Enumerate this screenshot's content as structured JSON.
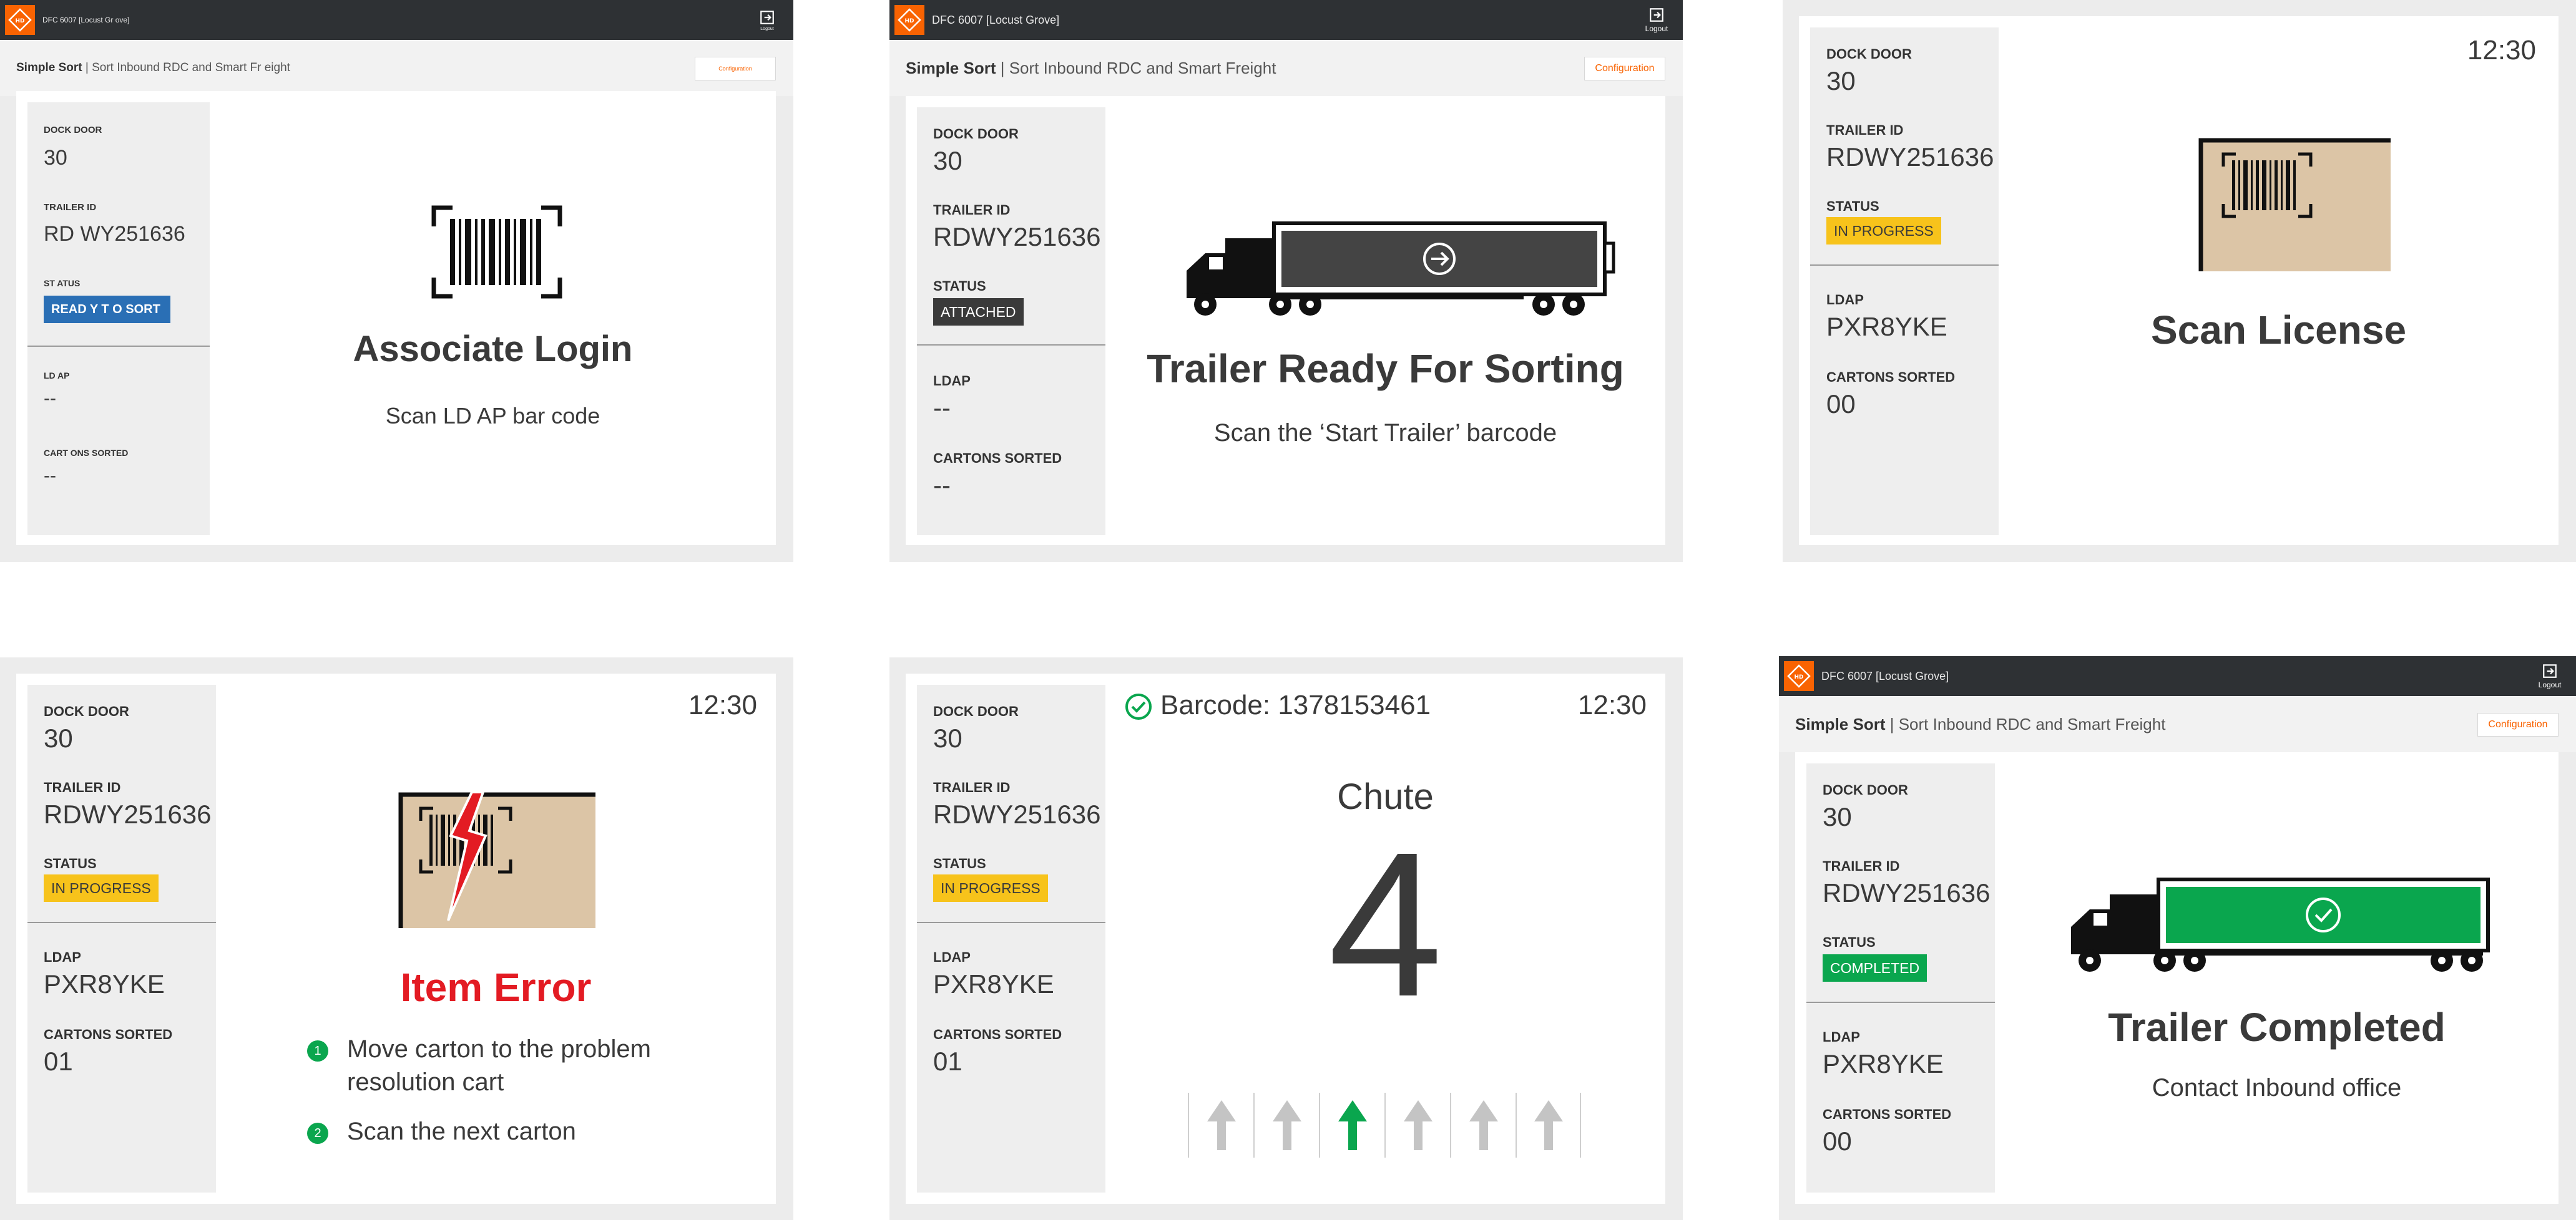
{
  "app": {
    "store_title": "DFC 6007 [Locust Grove]",
    "store_title_panel1": "DFC 6007 [Locust Gr        ove]",
    "logout_label": "Logout",
    "subheader_app": "Simple Sort",
    "subheader_desc": "| Sort Inbound RDC and Smart Freight",
    "subheader_desc_panel1": "| Sort Inbound RDC and Smart Fr        eight",
    "config_label": "Configuration"
  },
  "labels": {
    "dock_door": "DOCK DOOR",
    "trailer_id": "TRAILER ID",
    "status": "STATUS",
    "ldap": "LDAP",
    "cartons_sorted": "CARTONS SORTED"
  },
  "panel1": {
    "labels": {
      "dock_door": "DOCK DOOR",
      "trailer_id": "TRAILER ID",
      "status": "ST  ATUS",
      "ldap": "LD  AP",
      "cartons_sorted": "CART    ONS SORTED"
    },
    "dock_door": "30",
    "trailer_id": "RD WY251636",
    "status": "READ  Y T  O SORT",
    "ldap": "--",
    "cartons": "--",
    "title": "Associate Login",
    "subtitle": "Scan LD  AP bar  code"
  },
  "panel2": {
    "dock_door": "30",
    "trailer_id": "RDWY251636",
    "status": "ATTACHED",
    "ldap": "--",
    "cartons": "--",
    "title": "Trailer Ready For Sorting",
    "subtitle": "Scan the ‘Start Trailer’ barcode"
  },
  "panel3": {
    "dock_door": "30",
    "trailer_id": "RDWY251636",
    "status": "IN PROGRESS",
    "ldap": "PXR8YKE",
    "cartons": "00",
    "clock": "12:30",
    "title": "Scan License"
  },
  "panel4": {
    "dock_door": "30",
    "trailer_id": "RDWY251636",
    "status": "IN PROGRESS",
    "ldap": "PXR8YKE",
    "cartons": "01",
    "clock": "12:30",
    "title": "Item Error",
    "steps": [
      {
        "num": "1",
        "line1": "Move carton to the problem",
        "line2": "resolution cart"
      },
      {
        "num": "2",
        "line1": "Scan the next carton"
      }
    ]
  },
  "panel5": {
    "dock_door": "30",
    "trailer_id": "RDWY251636",
    "status": "IN PROGRESS",
    "ldap": "PXR8YKE",
    "cartons": "01",
    "clock": "12:30",
    "barcode": "Barcode: 1378153461",
    "chute_label": "Chute",
    "chute_number": "4",
    "chute_arrows": [
      {
        "active": false
      },
      {
        "active": false
      },
      {
        "active": true
      },
      {
        "active": false
      },
      {
        "active": false
      },
      {
        "active": false
      }
    ]
  },
  "panel6": {
    "dock_door": "30",
    "trailer_id": "RDWY251636",
    "status": "COMPLETED",
    "ldap": "PXR8YKE",
    "cartons": "00",
    "title": "Trailer Completed",
    "subtitle": "Contact Inbound office"
  },
  "colors": {
    "brand_orange": "#f96302",
    "app_bar": "#2e3134",
    "status_ready": "#2a6fb5",
    "status_attached": "#3a3a3a",
    "status_in_progress": "#f7c31b",
    "status_completed": "#0aa64e",
    "error_red": "#e31b23",
    "box_tan": "#dcc5a6"
  }
}
